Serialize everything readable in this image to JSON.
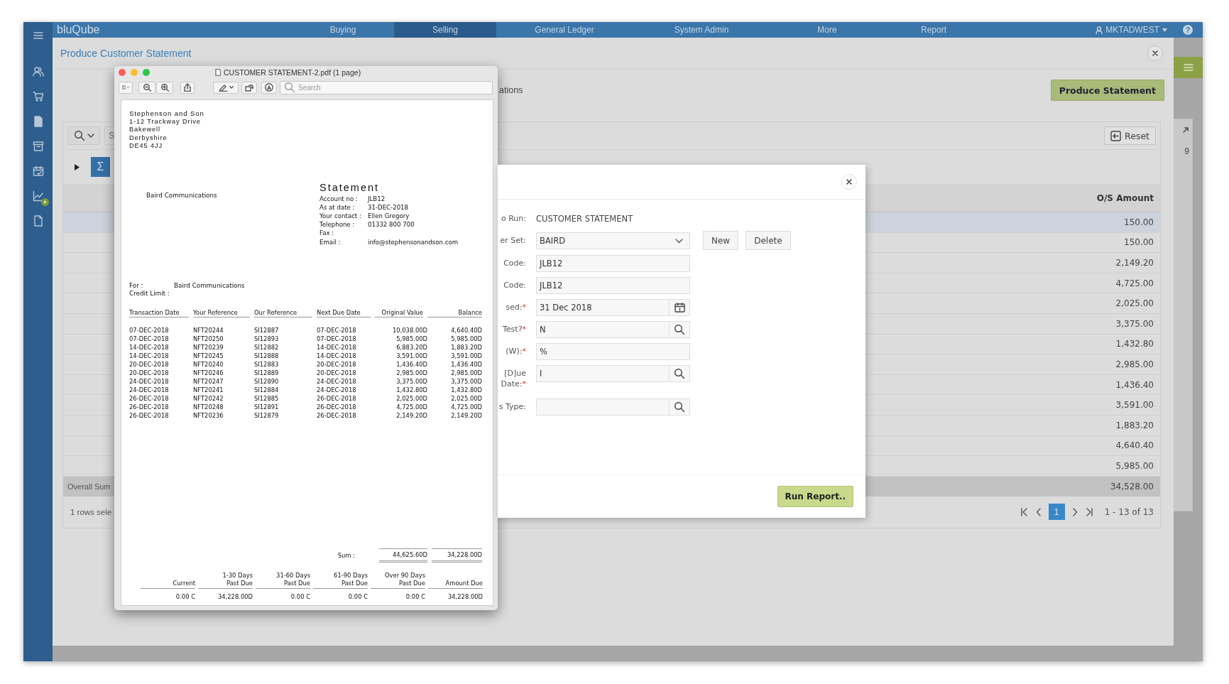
{
  "app": {
    "logo": "bluQube",
    "nav": [
      {
        "label": "Buying",
        "selected": false
      },
      {
        "label": "Selling",
        "selected": true
      },
      {
        "label": "General Ledger",
        "selected": false
      },
      {
        "label": "System Admin",
        "selected": false
      },
      {
        "label": "More",
        "selected": false
      },
      {
        "label": "Report",
        "selected": false
      }
    ],
    "user": "MKTADWEST",
    "help": "?"
  },
  "background_panel": {
    "count": "9"
  },
  "statement_modal": {
    "title": "Produce Customer Statement",
    "action_button": "Produce Statement",
    "partial_text": "ations",
    "filter_bar": {
      "search_text": "S",
      "reset_button": "Reset"
    },
    "sigma_button": "Σ",
    "table": {
      "columns": [
        "O/S Amount"
      ],
      "rows": [
        {
          "amount": "150.00",
          "selected": true
        },
        {
          "amount": "150.00",
          "selected": false
        },
        {
          "amount": "2,149.20",
          "selected": false
        },
        {
          "amount": "4,725.00",
          "selected": false
        },
        {
          "amount": "2,025.00",
          "selected": false
        },
        {
          "amount": "3,375.00",
          "selected": false
        },
        {
          "amount": "1,432.80",
          "selected": false
        },
        {
          "amount": "2,985.00",
          "selected": false
        },
        {
          "amount": "1,436.40",
          "selected": false
        },
        {
          "amount": "3,591.00",
          "selected": false
        },
        {
          "amount": "1,883.20",
          "selected": false
        },
        {
          "amount": "4,640.40",
          "selected": false
        },
        {
          "amount": "5,985.00",
          "selected": false
        }
      ],
      "summary": {
        "label": "Overall Sum",
        "amount": "34,528.00"
      },
      "footer": "1 rows sele",
      "pagination": {
        "pages": [
          {
            "label": "1",
            "selected": true
          }
        ],
        "range": "1 - 13 of 13"
      }
    }
  },
  "pdf_viewer": {
    "title": "CUSTOMER STATEMENT-2.pdf (1 page)",
    "search_placeholder": "Search",
    "document": {
      "sender": [
        "Stephenson and Son",
        "1-12 Trackway Drive",
        "Bakewell",
        "Derbyshire",
        "DE45 4JJ"
      ],
      "recipient": "Baird Communications",
      "heading": "Statement",
      "details": [
        {
          "label": "Account no :",
          "value": "JLB12"
        },
        {
          "label": "As at date :",
          "value": "31-DEC-2018"
        },
        {
          "label": "Your contact :",
          "value": "Ellen Gregory"
        },
        {
          "label": "Telephone :",
          "value": "01332 800 700"
        },
        {
          "label": "Fax :"
        },
        {
          "label": "Email :",
          "value": "info@stephensonandson.com"
        }
      ],
      "for_label": "For :",
      "for_value": "Baird Communications",
      "credit_limit_label": "Credit Limit :",
      "columns": [
        "Transaction Date",
        "Your Reference",
        "Our Reference",
        "Next Due Date",
        "Original Value",
        "Balance"
      ],
      "rows": [
        [
          "07-DEC-2018",
          "NFT20244",
          "SI12887",
          "07-DEC-2018",
          "10,038.00D",
          "4,640.40D"
        ],
        [
          "07-DEC-2018",
          "NFT20250",
          "SI12893",
          "07-DEC-2018",
          "5,985.00D",
          "5,985.00D"
        ],
        [
          "14-DEC-2018",
          "NFT20239",
          "SI12882",
          "14-DEC-2018",
          "6,883.20D",
          "1,883.20D"
        ],
        [
          "14-DEC-2018",
          "NFT20245",
          "SI12888",
          "14-DEC-2018",
          "3,591.00D",
          "3,591.00D"
        ],
        [
          "20-DEC-2018",
          "NFT20240",
          "SI12883",
          "20-DEC-2018",
          "1,436.40D",
          "1,436.40D"
        ],
        [
          "20-DEC-2018",
          "NFT20246",
          "SI12889",
          "20-DEC-2018",
          "2,985.00D",
          "2,985.00D"
        ],
        [
          "24-DEC-2018",
          "NFT20247",
          "SI12890",
          "24-DEC-2018",
          "3,375.00D",
          "3,375.00D"
        ],
        [
          "24-DEC-2018",
          "NFT20241",
          "SI12884",
          "24-DEC-2018",
          "1,432.80D",
          "1,432.80D"
        ],
        [
          "26-DEC-2018",
          "NFT20242",
          "SI12885",
          "26-DEC-2018",
          "2,025.00D",
          "2,025.00D"
        ],
        [
          "26-DEC-2018",
          "NFT20248",
          "SI12891",
          "26-DEC-2018",
          "4,725.00D",
          "4,725.00D"
        ],
        [
          "26-DEC-2018",
          "NFT20236",
          "SI12879",
          "26-DEC-2018",
          "2,149.20D",
          "2,149.20D"
        ]
      ],
      "sum_label": "Sum :",
      "sums": [
        "44,625.60D",
        "34,228.00D"
      ],
      "aging_columns": [
        {
          "label": "Current"
        },
        {
          "label": "1-30 Days",
          "sub": "Past Due"
        },
        {
          "label": "31-60 Days",
          "sub": "Past Due"
        },
        {
          "label": "61-90 Days",
          "sub": "Past Due"
        },
        {
          "label": "Over 90 Days",
          "sub": "Past Due"
        },
        {
          "label": "Amount Due"
        }
      ],
      "aging_values": [
        "0.00 C",
        "34,228.00D",
        "0.00 C",
        "0.00 C",
        "0.00 C",
        "34,228.00D"
      ]
    }
  },
  "report_dialog": {
    "fields": [
      {
        "kind": "text",
        "label": "o Run:",
        "value": "CUSTOMER STATEMENT"
      },
      {
        "kind": "select",
        "label": "er Set:",
        "value": "BAIRD",
        "buttons": [
          "New",
          "Delete"
        ]
      },
      {
        "kind": "input",
        "label": "Code:",
        "value": "JLB12"
      },
      {
        "kind": "input",
        "label": "Code:",
        "value": "JLB12"
      },
      {
        "kind": "date",
        "label": "sed:",
        "required_mark": "*",
        "value": "31 Dec 2018"
      },
      {
        "kind": "lookup",
        "label": "Test?",
        "required_mark": "*",
        "value": "N"
      },
      {
        "kind": "input",
        "label": "(W):",
        "required_mark": "*",
        "value": "%"
      },
      {
        "kind": "lookup",
        "label": "[D]ue Date:",
        "required_mark": "*",
        "value": "I"
      },
      {
        "kind": "lookup",
        "label": "s Type:"
      }
    ],
    "run_button": "Run Report.."
  }
}
